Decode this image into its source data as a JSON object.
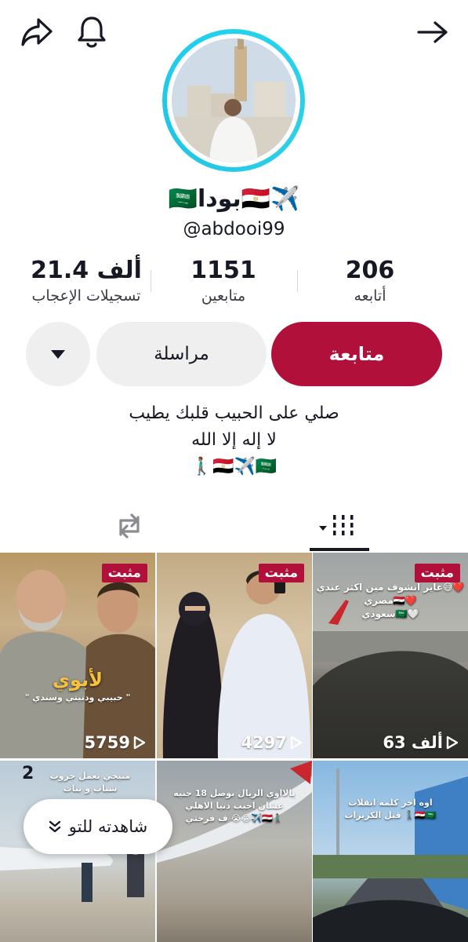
{
  "profile": {
    "display_name": "🇸🇦بودا🇪🇬✈️",
    "handle": "@abdooi99",
    "stats": [
      {
        "value": "206",
        "label": "أتابعه"
      },
      {
        "value": "1151",
        "label": "متابعين"
      },
      {
        "value": "21.4 ألف",
        "label": "تسجيلات الإعجاب"
      }
    ],
    "bio_lines": [
      "صلي على الحبيب قلبك يطيب",
      "لا إله إلا الله",
      "🚶🏽‍♂️🇪🇬✈️🇸🇦"
    ]
  },
  "actions": {
    "follow": "متابعة",
    "message": "مراسلة"
  },
  "videos": [
    {
      "pinned": "مثبت",
      "views": "5759",
      "caption_title": "لأبوي",
      "caption_sub": "\" حبيبي ودنيتي وسندي \""
    },
    {
      "pinned": "مثبت",
      "views": "4297"
    },
    {
      "pinned": "مثبت",
      "views": "63 ألف",
      "caption_lines": [
        "عاير انشوف مين اكثر عندي😅❤️",
        "مصري🇪🇬❤️",
        "سعودي🇸🇦🤍"
      ]
    },
    {
      "badge": "2",
      "caption_lines": [
        "متيجي نعمل جروب",
        "شباب و بنات"
      ]
    },
    {
      "caption_lines": [
        "يالااوي الريال بوصل 18 جنيه",
        "عشان اجيب دنيا الاهلي",
        "ف فرحتي 😭😂✈️🇪🇬🚶🏽‍♂️"
      ]
    },
    {
      "caption_lines": [
        "اوه اخر كلمه انقلات",
        "قبل الكريزات 🚶🏽‍♂️🇪🇬🇸🇦"
      ]
    }
  ],
  "watched_pill": "شاهدته للتو",
  "colors": {
    "accent": "#b0103a",
    "ring": "#22d3ee"
  }
}
